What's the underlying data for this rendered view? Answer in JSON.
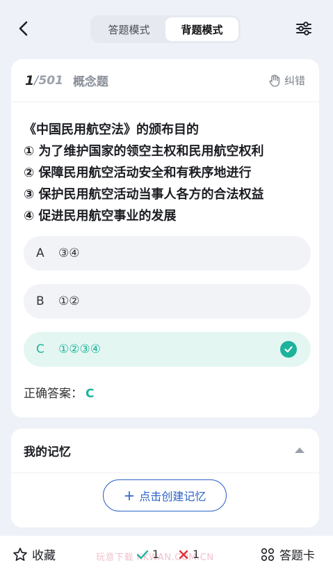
{
  "header": {
    "tabs": [
      {
        "label": "答题模式",
        "active": false
      },
      {
        "label": "背题模式",
        "active": true
      }
    ],
    "back_icon": "chevron-left-icon",
    "settings_icon": "sliders-icon"
  },
  "question": {
    "current": "1",
    "total": "/501",
    "type": "概念题",
    "report_label": "纠错",
    "lines": [
      "《中国民用航空法》的颁布目的",
      "① 为了维护国家的领空主权和民用航空权利",
      "② 保障民用航空活动安全和有秩序地进行",
      "③ 保护民用航空活动当事人各方的合法权益",
      "④ 促进民用航空事业的发展"
    ],
    "options": [
      {
        "letter": "A",
        "text": "③④",
        "correct": false
      },
      {
        "letter": "B",
        "text": "①②",
        "correct": false
      },
      {
        "letter": "C",
        "text": "①②③④",
        "correct": true
      }
    ],
    "answer_label": "正确答案：",
    "answer_value": "C"
  },
  "memory": {
    "title": "我的记忆",
    "create_label": "点击创建记忆"
  },
  "bottom": {
    "favorite_label": "收藏",
    "watermark": "玩意下载 KKWAN.COM.CN",
    "correct_count": "1",
    "wrong_count": "1",
    "answer_card_label": "答题卡"
  },
  "colors": {
    "accent_green": "#1cb39a",
    "accent_blue": "#2c63c9",
    "wrong_red": "#e0303a",
    "background": "#eef1f7"
  }
}
